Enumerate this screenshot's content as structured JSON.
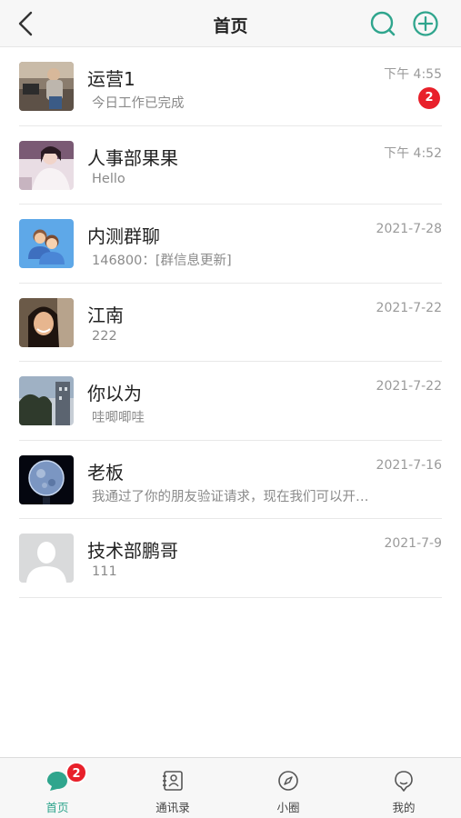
{
  "header": {
    "title": "首页",
    "back_icon": "chevron-left-icon",
    "search_icon": "search-icon",
    "add_icon": "plus-circle-icon",
    "accent_color": "#2fa58d"
  },
  "chats": [
    {
      "name": "运营1",
      "preview": "今日工作已完成",
      "time": "下午 4:55",
      "unread": "2"
    },
    {
      "name": "人事部果果",
      "preview": "Hello",
      "time": "下午 4:52"
    },
    {
      "name": "内测群聊",
      "preview": "146800：[群信息更新]",
      "time": "2021-7-28"
    },
    {
      "name": "江南",
      "preview": "222",
      "time": "2021-7-22"
    },
    {
      "name": "你以为",
      "preview": "哇唧唧哇",
      "time": "2021-7-22"
    },
    {
      "name": "老板",
      "preview": "我通过了你的朋友验证请求，现在我们可以开…",
      "time": "2021-7-16"
    },
    {
      "name": "技术部鹏哥",
      "preview": "111",
      "time": "2021-7-9"
    }
  ],
  "tabbar": {
    "tabs": [
      {
        "label": "首页",
        "icon": "chat-bubble-icon",
        "badge": "2",
        "active": true
      },
      {
        "label": "通讯录",
        "icon": "contacts-icon"
      },
      {
        "label": "小圈",
        "icon": "compass-icon"
      },
      {
        "label": "我的",
        "icon": "profile-icon"
      }
    ]
  }
}
